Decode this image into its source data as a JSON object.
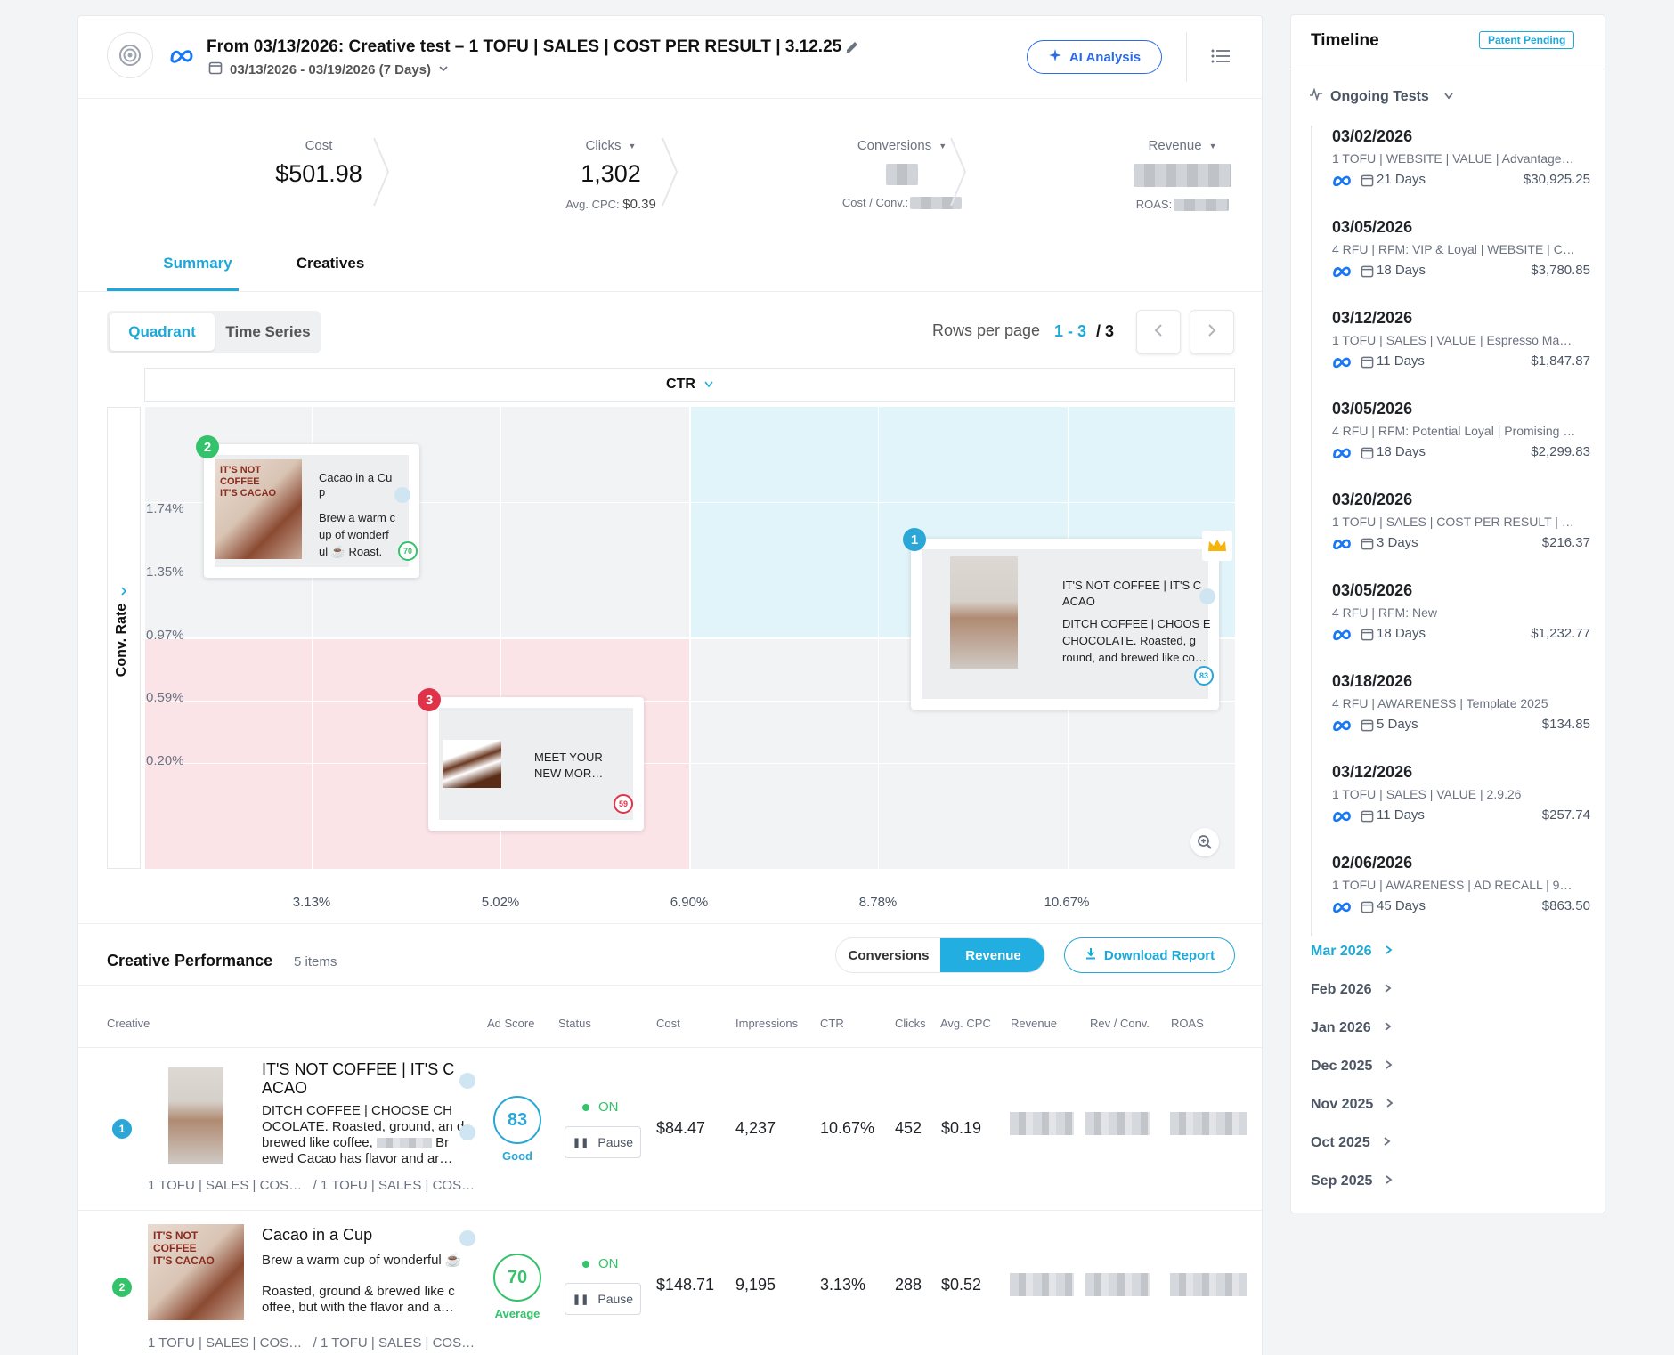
{
  "header": {
    "title": "From 03/13/2026: Creative test – 1 TOFU | SALES | COST PER RESULT | 3.12.25",
    "date_range": "03/13/2026 - 03/19/2026 (7 Days)",
    "ai_button": "AI Analysis"
  },
  "kpis": {
    "cost": {
      "label": "Cost",
      "value": "$501.98"
    },
    "clicks": {
      "label": "Clicks",
      "value": "1,302",
      "sub_label": "Avg. CPC:",
      "sub_value": "$0.39"
    },
    "conversions": {
      "label": "Conversions",
      "sub_label": "Cost / Conv.:"
    },
    "revenue": {
      "label": "Revenue",
      "sub_label": "ROAS:"
    }
  },
  "tabs": {
    "summary": "Summary",
    "creatives": "Creatives"
  },
  "view_toggle": {
    "quadrant": "Quadrant",
    "time_series": "Time Series"
  },
  "pagination": {
    "label": "Rows per page",
    "range": "1 - 3",
    "total": "/ 3"
  },
  "quadrant": {
    "x_metric": "CTR",
    "y_metric": "Conv. Rate",
    "y_ticks": [
      "1.74%",
      "1.35%",
      "0.97%",
      "0.59%",
      "0.20%"
    ],
    "x_ticks": [
      "3.13%",
      "5.02%",
      "6.90%",
      "8.78%",
      "10.67%"
    ],
    "cards": [
      {
        "rank": "1",
        "title": "IT'S NOT COFFEE | IT'S C ACAO",
        "body": "DITCH COFFEE | CHOOS E CHOCOLATE. Roasted, g round, and brewed like co…",
        "score": "83",
        "color": "#2aa7d6"
      },
      {
        "rank": "2",
        "title": "Cacao in a Cu p",
        "body": "Brew a warm c up of wonderf ul ☕ Roast.",
        "score": "70",
        "color": "#34c26b"
      },
      {
        "rank": "3",
        "title": "MEET YOUR NEW MOR…",
        "body": "",
        "score": "59",
        "color": "#e0334a"
      }
    ]
  },
  "performance": {
    "title": "Creative Performance",
    "count": "5 items",
    "toggle_conversions": "Conversions",
    "toggle_revenue": "Revenue",
    "download": "Download Report",
    "columns": [
      "Creative",
      "Ad Score",
      "Status",
      "Cost",
      "Impressions",
      "CTR",
      "Clicks",
      "Avg. CPC",
      "Revenue",
      "Rev / Conv.",
      "ROAS"
    ],
    "rows": [
      {
        "rank": "1",
        "title": "IT'S NOT COFFEE | IT'S C ACAO",
        "body1": "DITCH COFFEE | CHOOSE CH OCOLATE. Roasted, ground, an d brewed like coffee,",
        "body2": "Br ewed Cacao has flavor and ar…",
        "tags": "1 TOFU | SALES | COS…   / 1 TOFU | SALES | COS…",
        "score": "83",
        "score_label": "Good",
        "status": "ON",
        "pause": "Pause",
        "cost": "$84.47",
        "impressions": "4,237",
        "ctr": "10.67%",
        "clicks": "452",
        "cpc": "$0.19"
      },
      {
        "rank": "2",
        "title": "Cacao in a Cup",
        "body1": "Brew a warm cup of wonderful ☕",
        "body2": "Roasted, ground & brewed like c offee, but with the flavor and a…",
        "tags": "1 TOFU | SALES | COS…   / 1 TOFU | SALES | COS…",
        "score": "70",
        "score_label": "Average",
        "status": "ON",
        "pause": "Pause",
        "cost": "$148.71",
        "impressions": "9,195",
        "ctr": "3.13%",
        "clicks": "288",
        "cpc": "$0.52"
      }
    ]
  },
  "timeline": {
    "title": "Timeline",
    "badge": "Patent Pending",
    "ongoing": "Ongoing Tests",
    "items": [
      {
        "date": "03/02/2026",
        "name": "1 TOFU | WEBSITE | VALUE | Advantage…",
        "days": "21 Days",
        "amount": "$30,925.25"
      },
      {
        "date": "03/05/2026",
        "name": "4 RFU | RFM: VIP & Loyal | WEBSITE | C…",
        "days": "18 Days",
        "amount": "$3,780.85"
      },
      {
        "date": "03/12/2026",
        "name": "1 TOFU | SALES | VALUE | Espresso Ma…",
        "days": "11 Days",
        "amount": "$1,847.87"
      },
      {
        "date": "03/05/2026",
        "name": "4 RFU | RFM: Potential Loyal | Promising …",
        "days": "18 Days",
        "amount": "$2,299.83"
      },
      {
        "date": "03/20/2026",
        "name": "1 TOFU | SALES | COST PER RESULT | …",
        "days": "3 Days",
        "amount": "$216.37"
      },
      {
        "date": "03/05/2026",
        "name": "4 RFU | RFM: New",
        "days": "18 Days",
        "amount": "$1,232.77"
      },
      {
        "date": "03/18/2026",
        "name": "4 RFU | AWARENESS | Template 2025",
        "days": "5 Days",
        "amount": "$134.85"
      },
      {
        "date": "03/12/2026",
        "name": "1 TOFU | SALES | VALUE | 2.9.26",
        "days": "11 Days",
        "amount": "$257.74"
      },
      {
        "date": "02/06/2026",
        "name": "1 TOFU | AWARENESS | AD RECALL | 9…",
        "days": "45 Days",
        "amount": "$863.50"
      }
    ],
    "months": [
      "Mar 2026",
      "Feb 2026",
      "Jan 2026",
      "Dec 2025",
      "Nov 2025",
      "Oct 2025",
      "Sep 2025"
    ]
  }
}
